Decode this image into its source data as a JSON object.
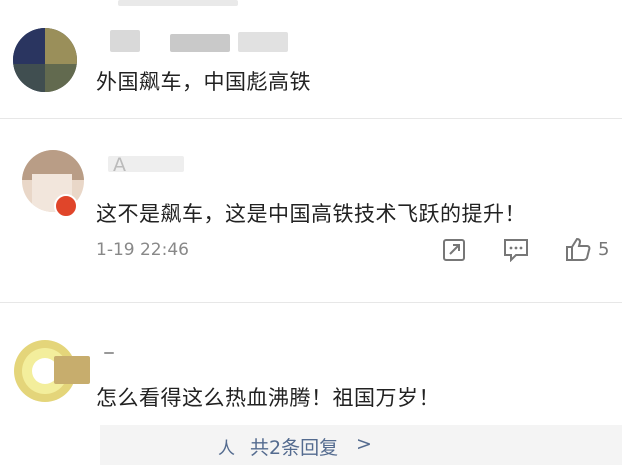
{
  "comments": [
    {
      "name": "",
      "text": "外国飙车，中国彪高铁"
    },
    {
      "name": "A",
      "text": "这不是飙车，这是中国高铁技术飞跃的提升！",
      "time": "1-19 22:46",
      "likes": "5",
      "icons": [
        "share-icon",
        "comment-icon",
        "like-icon"
      ]
    },
    {
      "name": "",
      "text": "怎么看得这么热血沸腾！祖国万岁！",
      "replies": {
        "label": "共2条回复",
        "icon": "person-icon",
        "arrow": ">"
      }
    }
  ],
  "colors": {
    "reply_link": "#546b8f",
    "meta": "#888888",
    "separator": "#e7e7e7",
    "verified_badge": "#e0452a"
  }
}
